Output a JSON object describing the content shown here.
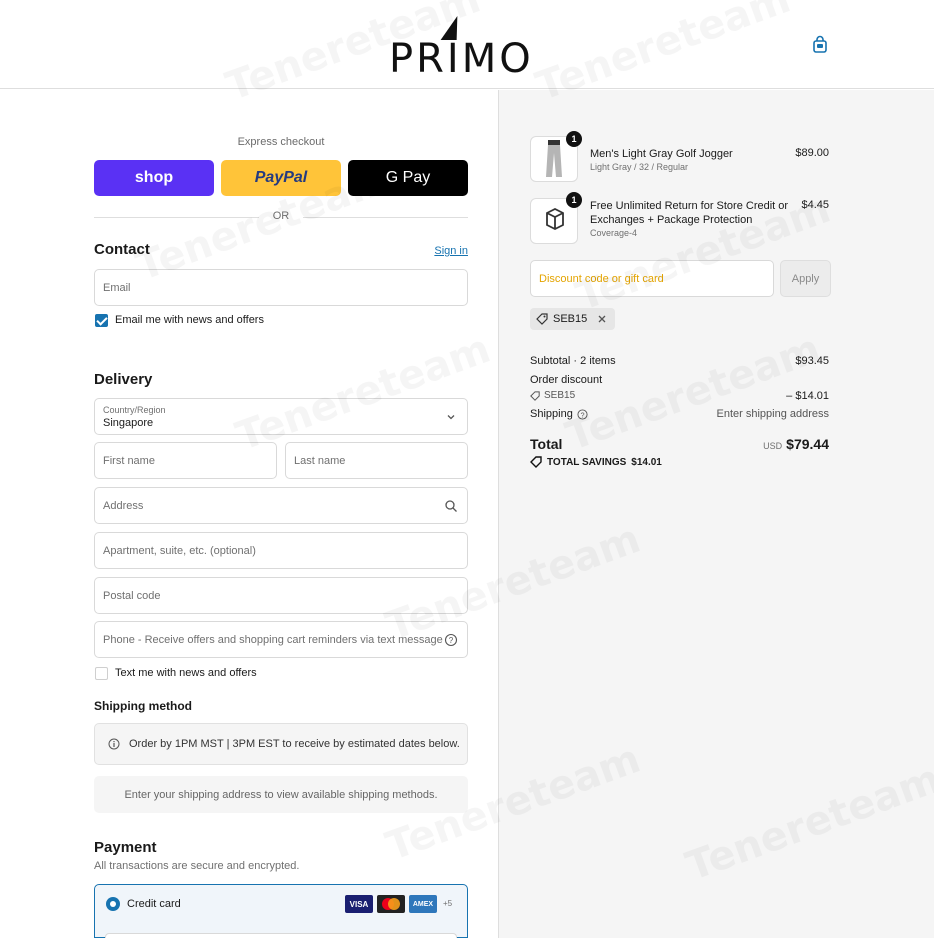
{
  "header": {
    "logo_text": "PRIMO",
    "cart_icon": "shopping-bag-icon"
  },
  "express": {
    "title": "Express checkout",
    "shop_label": "shop",
    "paypal_label": "PayPal",
    "gpay_label": "G Pay",
    "or_label": "OR"
  },
  "contact": {
    "title": "Contact",
    "signin_label": "Sign in",
    "email_placeholder": "Email",
    "news_label": "Email me with news and offers",
    "news_checked": true
  },
  "delivery": {
    "title": "Delivery",
    "country_label": "Country/Region",
    "country_value": "Singapore",
    "first_name_placeholder": "First name",
    "last_name_placeholder": "Last name",
    "address_placeholder": "Address",
    "apartment_placeholder": "Apartment, suite, etc. (optional)",
    "postal_placeholder": "Postal code",
    "phone_placeholder": "Phone - Receive offers and shopping cart reminders via text message",
    "text_label": "Text me with news and offers",
    "text_checked": false
  },
  "shipping": {
    "title": "Shipping method",
    "notice": "Order by 1PM MST | 3PM EST to receive by estimated dates below.",
    "empty_message": "Enter your shipping address to view available shipping methods."
  },
  "payment": {
    "title": "Payment",
    "subtitle": "All transactions are secure and encrypted.",
    "credit_card_label": "Credit card",
    "more_cards": "+5",
    "card_brands": [
      "VISA",
      "mastercard",
      "AMEX"
    ]
  },
  "summary": {
    "items": [
      {
        "name": "Men's Light Gray Golf Jogger",
        "variant": "Light Gray / 32 / Regular",
        "price": "$89.00",
        "qty": "1"
      },
      {
        "name": "Free Unlimited Return for Store Credit or Exchanges + Package Protection",
        "variant": "Coverage-4",
        "price": "$4.45",
        "qty": "1"
      }
    ],
    "discount_placeholder": "Discount code or gift card",
    "apply_label": "Apply",
    "applied_code": "SEB15",
    "subtotal_label": "Subtotal · 2 items",
    "subtotal_value": "$93.45",
    "order_discount_label": "Order discount",
    "discount_code": "SEB15",
    "discount_value": "– $14.01",
    "shipping_label": "Shipping",
    "shipping_value": "Enter shipping address",
    "total_label": "Total",
    "currency": "USD",
    "total_value": "$79.44",
    "savings_label": "TOTAL SAVINGS",
    "savings_value": "$14.01"
  },
  "watermark": "Tenereteam"
}
